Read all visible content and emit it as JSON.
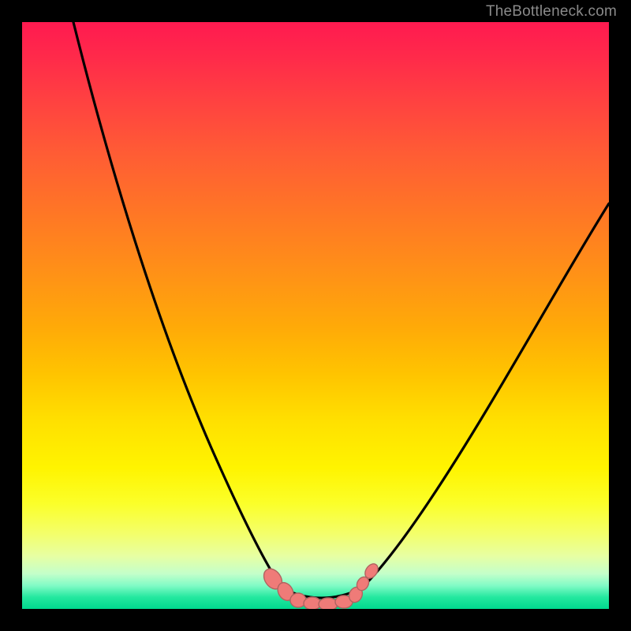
{
  "watermark": {
    "text": "TheBottleneck.com"
  },
  "colors": {
    "black": "#000000",
    "curve_stroke": "#000000",
    "bump_fill": "#ef7b78",
    "bump_stroke": "#913a3a",
    "gradient_top": "#ff1a50",
    "gradient_bottom": "#00d98e"
  },
  "chart_data": {
    "type": "line",
    "title": "",
    "xlabel": "",
    "ylabel": "",
    "x": [
      0,
      5,
      10,
      15,
      20,
      25,
      30,
      35,
      40,
      42,
      44,
      46,
      48,
      50,
      52,
      54,
      56,
      60,
      65,
      70,
      75,
      80,
      85,
      90,
      95,
      100
    ],
    "series": [
      {
        "name": "curve",
        "values": [
          100,
          92,
          84,
          75,
          66,
          56,
          45,
          30,
          12,
          5,
          1,
          0,
          0,
          0,
          0,
          0,
          1,
          5,
          12,
          20,
          27,
          34,
          40,
          46,
          51,
          56
        ]
      }
    ],
    "xlim": [
      0,
      100
    ],
    "ylim": [
      0,
      100
    ],
    "bumps_x": [
      41,
      43,
      45,
      47,
      49,
      51,
      53,
      55,
      57
    ],
    "bumps_y": [
      5,
      2,
      0.5,
      0.2,
      0.3,
      0.2,
      0.6,
      2.5,
      6
    ]
  }
}
